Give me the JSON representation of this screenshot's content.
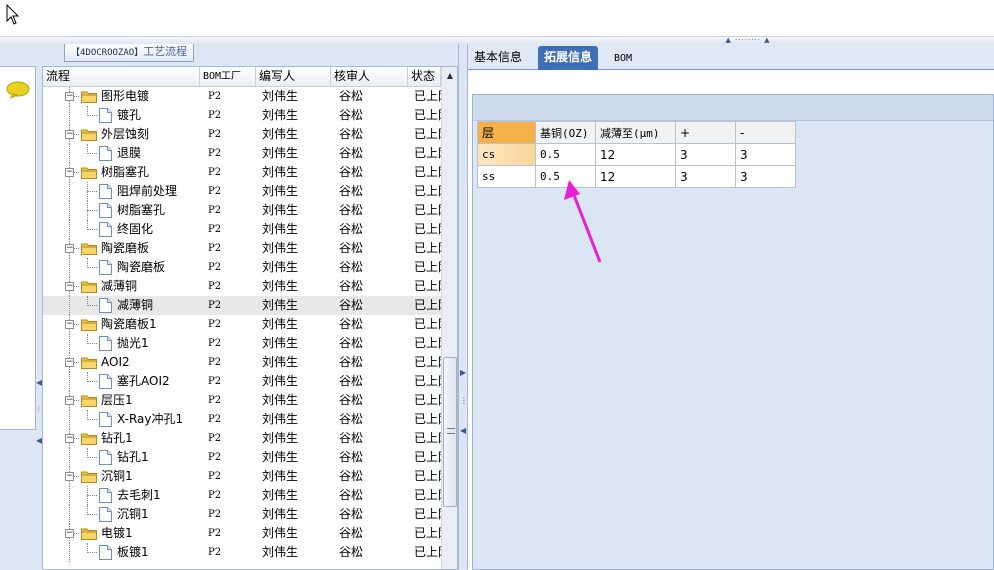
{
  "left_panel": {
    "title_code": "【4DOCROOZAO】",
    "title_name": "工艺流程"
  },
  "tree": {
    "columns": [
      "流程",
      "BOM工厂",
      "编写人",
      "核审人",
      "状态"
    ],
    "rows": [
      {
        "level": 1,
        "type": "folder",
        "label": "图形电镀",
        "bom": "P2",
        "writer": "刘伟生",
        "reviewer": "谷松",
        "status": "已上网"
      },
      {
        "level": 2,
        "type": "doc",
        "label": "镀孔",
        "bom": "P2",
        "writer": "刘伟生",
        "reviewer": "谷松",
        "status": "已上网"
      },
      {
        "level": 1,
        "type": "folder",
        "label": "外层蚀刻",
        "bom": "P2",
        "writer": "刘伟生",
        "reviewer": "谷松",
        "status": "已上网"
      },
      {
        "level": 2,
        "type": "doc",
        "label": "退膜",
        "bom": "P2",
        "writer": "刘伟生",
        "reviewer": "谷松",
        "status": "已上网"
      },
      {
        "level": 1,
        "type": "folder",
        "label": "树脂塞孔",
        "bom": "P2",
        "writer": "刘伟生",
        "reviewer": "谷松",
        "status": "已上网"
      },
      {
        "level": 2,
        "type": "doc",
        "label": "阻焊前处理",
        "bom": "P2",
        "writer": "刘伟生",
        "reviewer": "谷松",
        "status": "已上网"
      },
      {
        "level": 2,
        "type": "doc",
        "label": "树脂塞孔",
        "bom": "P2",
        "writer": "刘伟生",
        "reviewer": "谷松",
        "status": "已上网"
      },
      {
        "level": 2,
        "type": "doc",
        "label": "终固化",
        "bom": "P2",
        "writer": "刘伟生",
        "reviewer": "谷松",
        "status": "已上网"
      },
      {
        "level": 1,
        "type": "folder",
        "label": "陶瓷磨板",
        "bom": "P2",
        "writer": "刘伟生",
        "reviewer": "谷松",
        "status": "已上网"
      },
      {
        "level": 2,
        "type": "doc",
        "label": "陶瓷磨板",
        "bom": "P2",
        "writer": "刘伟生",
        "reviewer": "谷松",
        "status": "已上网"
      },
      {
        "level": 1,
        "type": "folder",
        "label": "减薄铜",
        "bom": "P2",
        "writer": "刘伟生",
        "reviewer": "谷松",
        "status": "已上网"
      },
      {
        "level": 2,
        "type": "doc",
        "label": "减薄铜",
        "bom": "P2",
        "writer": "刘伟生",
        "reviewer": "谷松",
        "status": "已上网",
        "selected": true
      },
      {
        "level": 1,
        "type": "folder",
        "label": "陶瓷磨板1",
        "bom": "P2",
        "writer": "刘伟生",
        "reviewer": "谷松",
        "status": "已上网"
      },
      {
        "level": 2,
        "type": "doc",
        "label": "抛光1",
        "bom": "P2",
        "writer": "刘伟生",
        "reviewer": "谷松",
        "status": "已上网"
      },
      {
        "level": 1,
        "type": "folder",
        "label": "AOI2",
        "bom": "P2",
        "writer": "刘伟生",
        "reviewer": "谷松",
        "status": "已上网"
      },
      {
        "level": 2,
        "type": "doc",
        "label": "塞孔AOI2",
        "bom": "P2",
        "writer": "刘伟生",
        "reviewer": "谷松",
        "status": "已上网"
      },
      {
        "level": 1,
        "type": "folder",
        "label": "层压1",
        "bom": "P2",
        "writer": "刘伟生",
        "reviewer": "谷松",
        "status": "已上网"
      },
      {
        "level": 2,
        "type": "doc",
        "label": "X-Ray冲孔1",
        "bom": "P2",
        "writer": "刘伟生",
        "reviewer": "谷松",
        "status": "已上网"
      },
      {
        "level": 1,
        "type": "folder",
        "label": "钻孔1",
        "bom": "P2",
        "writer": "刘伟生",
        "reviewer": "谷松",
        "status": "已上网"
      },
      {
        "level": 2,
        "type": "doc",
        "label": "钻孔1",
        "bom": "P2",
        "writer": "刘伟生",
        "reviewer": "谷松",
        "status": "已上网"
      },
      {
        "level": 1,
        "type": "folder",
        "label": "沉铜1",
        "bom": "P2",
        "writer": "刘伟生",
        "reviewer": "谷松",
        "status": "已上网"
      },
      {
        "level": 2,
        "type": "doc",
        "label": "去毛刺1",
        "bom": "P2",
        "writer": "刘伟生",
        "reviewer": "谷松",
        "status": "已上网"
      },
      {
        "level": 2,
        "type": "doc",
        "label": "沉铜1",
        "bom": "P2",
        "writer": "刘伟生",
        "reviewer": "谷松",
        "status": "已上网"
      },
      {
        "level": 1,
        "type": "folder",
        "label": "电镀1",
        "bom": "P2",
        "writer": "刘伟生",
        "reviewer": "谷松",
        "status": "已上网"
      },
      {
        "level": 2,
        "type": "doc",
        "label": "板镀1",
        "bom": "P2",
        "writer": "刘伟生",
        "reviewer": "谷松",
        "status": "已上网"
      }
    ]
  },
  "right_panel": {
    "tabs": [
      {
        "label": "基本信息",
        "active": false
      },
      {
        "label": "拓展信息",
        "active": true
      },
      {
        "label": "BOM",
        "active": false
      }
    ],
    "grid": {
      "headers": [
        "层",
        "基铜(OZ)",
        "减薄至(μm)",
        "+",
        "-"
      ],
      "rows": [
        [
          "cs",
          "0.5",
          "12",
          "3",
          "3"
        ],
        [
          "ss",
          "0.5",
          "12",
          "3",
          "3"
        ]
      ]
    }
  },
  "colors": {
    "accent_tab": "#3e6fb4",
    "annotation_arrow": "#e81fd9",
    "grid_header_highlight": "#f5b04a",
    "folder": "#f0c24a"
  },
  "icons": {
    "chat": "speech-bubble-icon",
    "folder": "folder-icon",
    "document": "document-icon",
    "cursor": "mouse-pointer-icon"
  }
}
